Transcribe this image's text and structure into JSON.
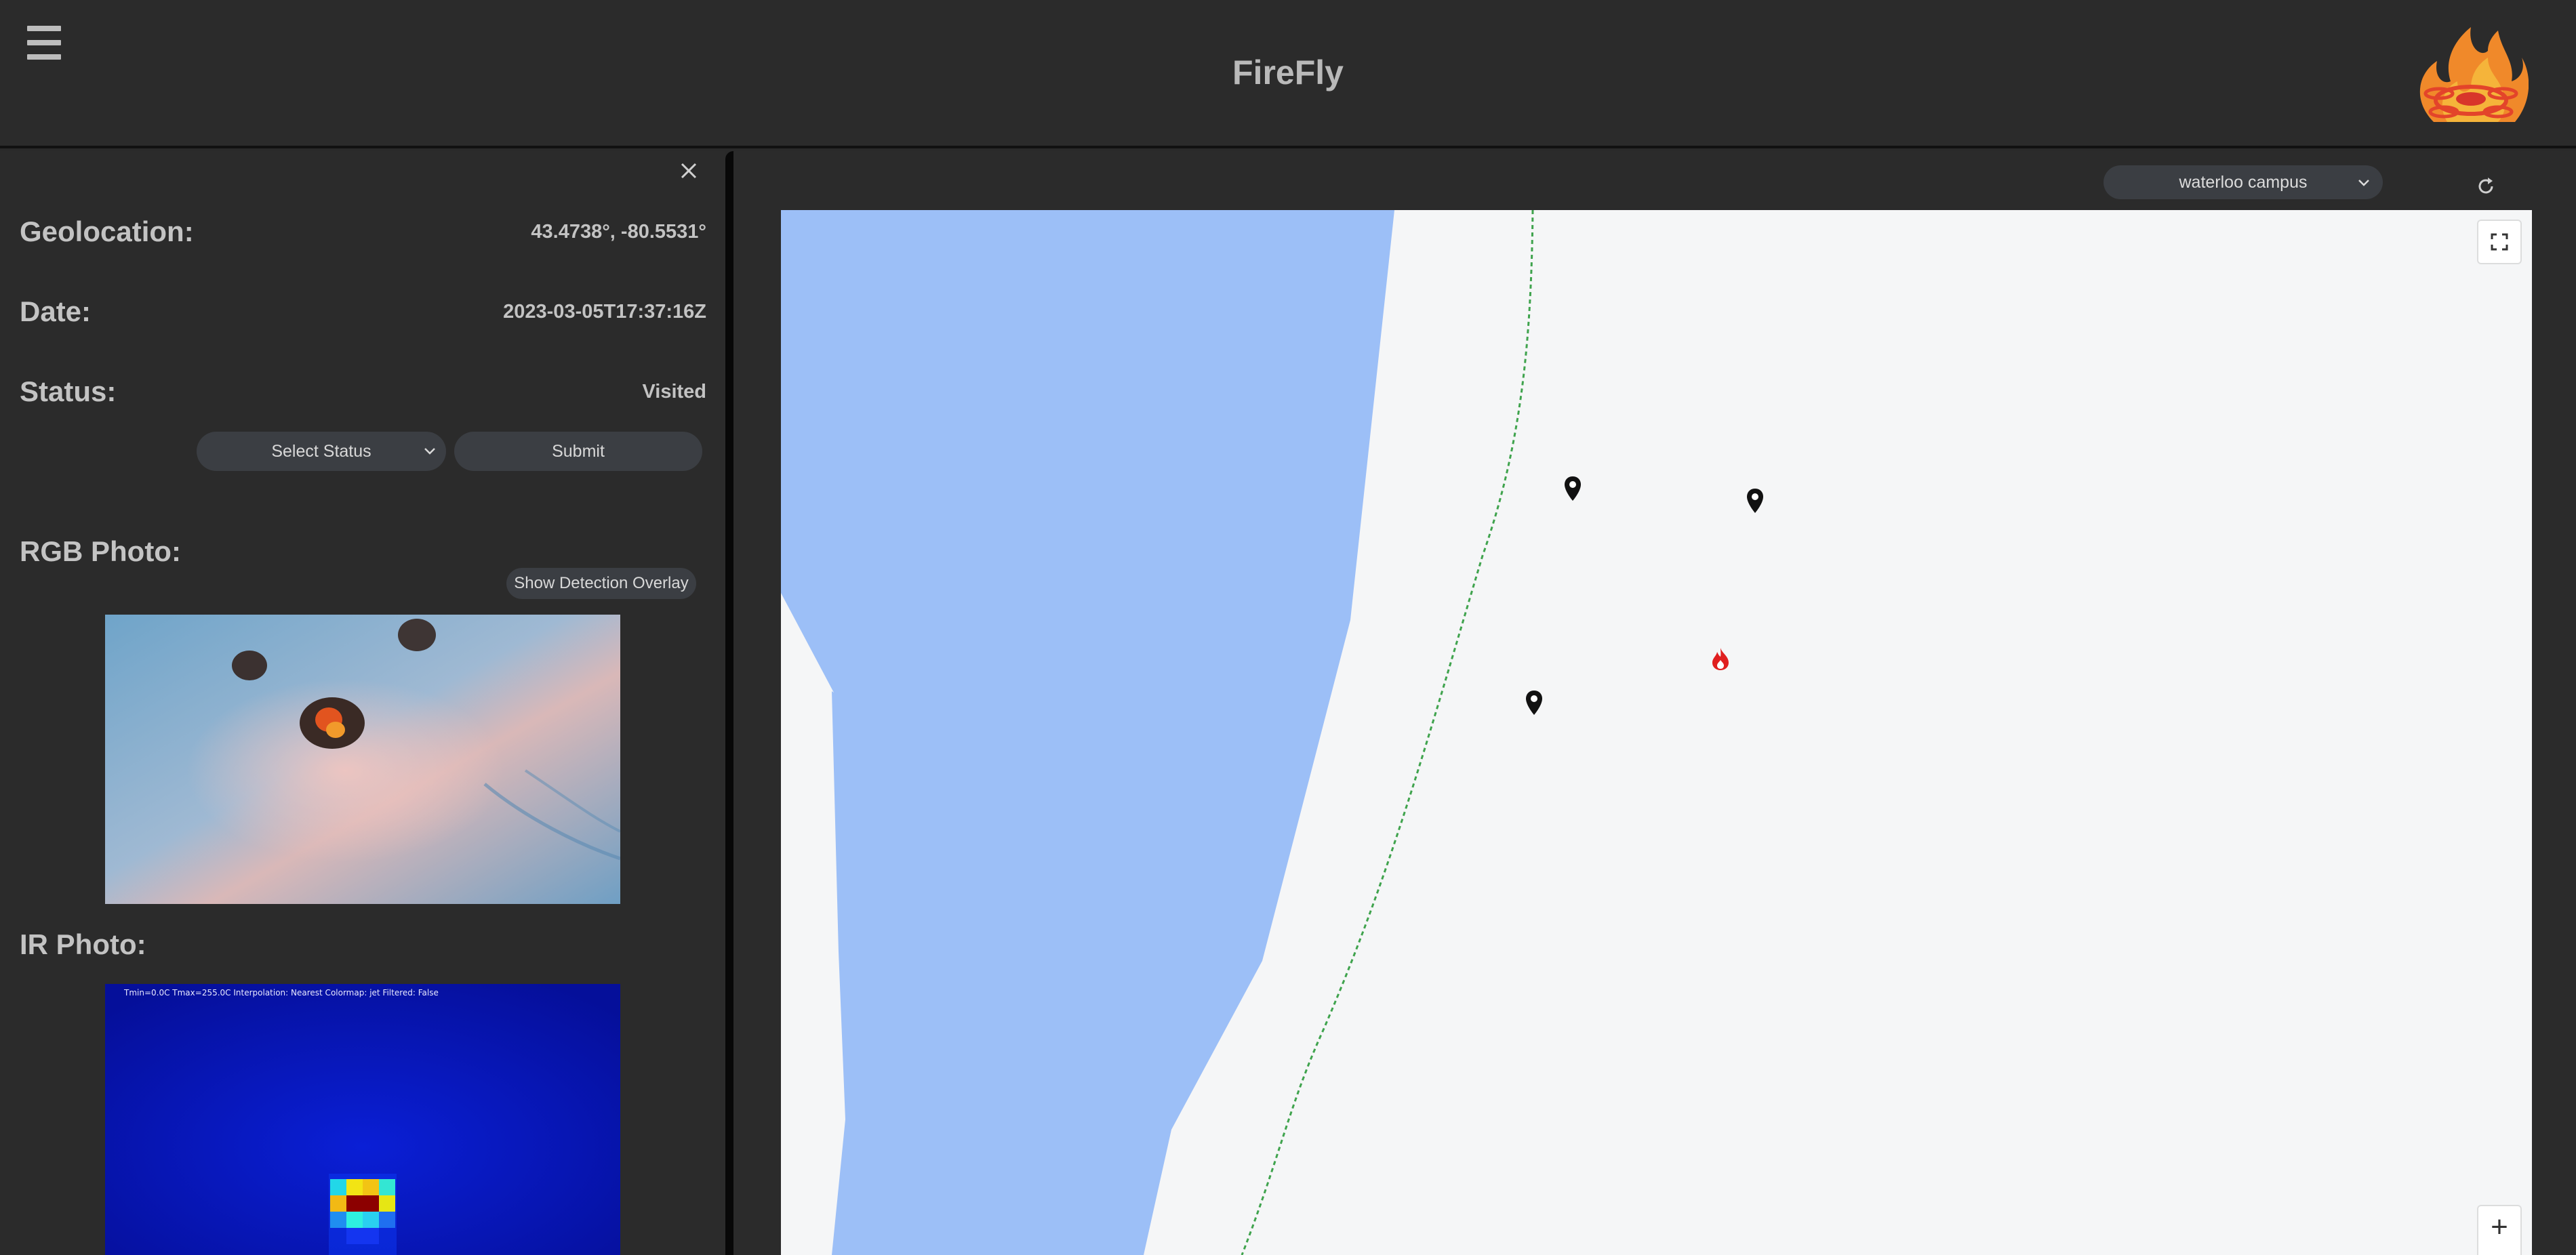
{
  "header": {
    "title": "FireFly",
    "menu_icon": "hamburger-menu-icon",
    "logo_icon": "firefly-drone-flame-logo"
  },
  "detail": {
    "close_icon": "close-icon",
    "geolocation": {
      "label": "Geolocation:",
      "value": "43.4738°, -80.5531°"
    },
    "date": {
      "label": "Date:",
      "value": "2023-03-05T17:37:16Z"
    },
    "status": {
      "label": "Status:",
      "value": "Visited"
    },
    "status_select": {
      "selected": "Select Status"
    },
    "submit_label": "Submit",
    "rgb": {
      "label": "RGB Photo:",
      "overlay_button": "Show Detection Overlay"
    },
    "ir": {
      "label": "IR Photo:",
      "caption": "Tmin=0.0C  Tmax=255.0C  Interpolation: Nearest  Colormap: jet  Filtered: False"
    }
  },
  "map": {
    "location_select": "waterloo campus",
    "refresh_icon": "refresh-icon",
    "fullscreen_icon": "fullscreen-icon",
    "zoom_in_label": "+",
    "colors": {
      "water": "#9cbff7",
      "land": "#f5f6f7",
      "trail": "#3fa34d",
      "fire": "#e01f1f"
    },
    "markers": [
      {
        "type": "location-pin-icon"
      },
      {
        "type": "location-pin-icon"
      },
      {
        "type": "location-pin-icon"
      },
      {
        "type": "fire-icon"
      }
    ]
  }
}
